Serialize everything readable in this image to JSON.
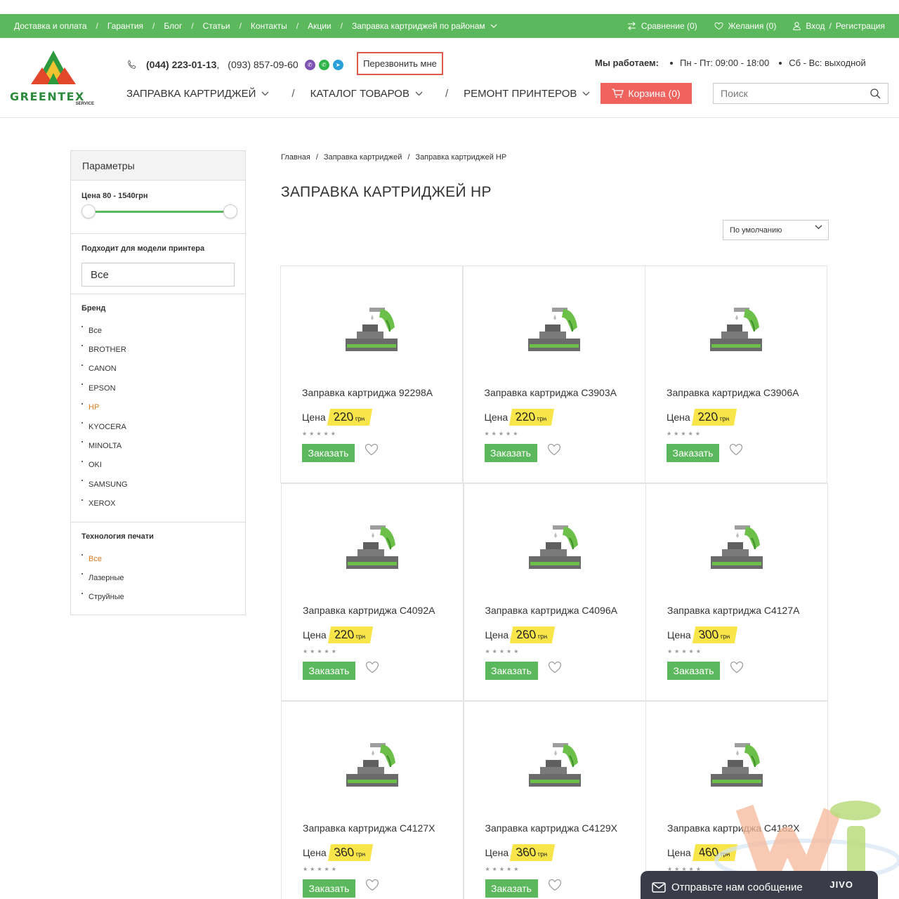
{
  "topbar": {
    "links": [
      "Доставка и оплата",
      "Гарантия",
      "Блог",
      "Статьи",
      "Контакты",
      "Акции",
      "Заправка картриджей по районам"
    ],
    "compare": "Сравнение (0)",
    "wishlist": "Желания (0)",
    "login": "Вход",
    "register": "Регистрация",
    "bg_color": "#5cb85c"
  },
  "header": {
    "logo_text": "GREENTEX",
    "logo_sub": "SERVICE",
    "phone1": "(044) 223-01-13",
    "phone2": "(093) 857-09-60",
    "callback": "Перезвонить мне",
    "hours_label": "Мы работаем:",
    "hours1": "Пн - Пт: 09:00 - 18:00",
    "hours2": "Сб - Вс: выходной",
    "nav": [
      "ЗАПРАВКА КАРТРИДЖЕЙ",
      "КАТАЛОГ ТОВАРОВ",
      "РЕМОНТ ПРИНТЕРОВ"
    ],
    "cart": "Корзина (0)",
    "search_placeholder": "Поиск"
  },
  "sidebar": {
    "title": "Параметры",
    "price_label": "Цена  80 - 1540грн",
    "model_label": "Подходит для модели принтера",
    "model_value": "Все",
    "brand_label": "Бренд",
    "brands": [
      "Все",
      "BROTHER",
      "CANON",
      "EPSON",
      "HP",
      "KYOCERA",
      "MINOLTA",
      "OKI",
      "SAMSUNG",
      "XEROX"
    ],
    "brand_active": "HP",
    "tech_label": "Технология печати",
    "tech": [
      "Все",
      "Лазерные",
      "Струйные"
    ],
    "tech_active": "Все"
  },
  "breadcrumb": [
    "Главная",
    "Заправка картриджей",
    "Заправка картриджей HP"
  ],
  "page_title": "ЗАПРАВКА КАРТРИДЖЕЙ HP",
  "sort_value": "По умолчанию",
  "product_labels": {
    "price": "Цена",
    "currency": "грн",
    "order": "Заказать"
  },
  "products": [
    {
      "name": "Заправка картриджа 92298A",
      "price": "220"
    },
    {
      "name": "Заправка картриджа C3903A",
      "price": "220"
    },
    {
      "name": "Заправка картриджа C3906A",
      "price": "220"
    },
    {
      "name": "Заправка картриджа C4092A",
      "price": "220"
    },
    {
      "name": "Заправка картриджа C4096A",
      "price": "260"
    },
    {
      "name": "Заправка картриджа C4127A",
      "price": "300"
    },
    {
      "name": "Заправка картриджа C4127X",
      "price": "360"
    },
    {
      "name": "Заправка картриджа C4129X",
      "price": "360"
    },
    {
      "name": "Заправка картриджа C4182X",
      "price": "460"
    }
  ],
  "chat": {
    "text": "Отправьте нам сообщение",
    "brand": "JIVO"
  },
  "colors": {
    "accent_green": "#5cb85c",
    "cart_red": "#f0625e",
    "price_yellow": "#f7e54a",
    "active_orange": "#d97a1e"
  }
}
